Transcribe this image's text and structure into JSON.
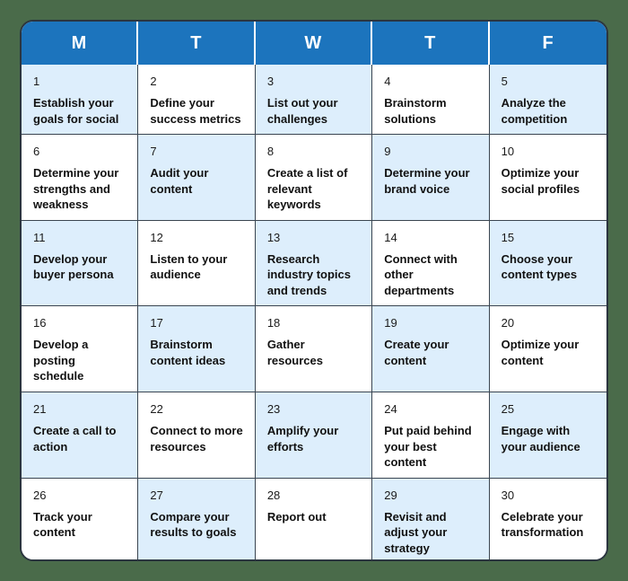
{
  "colors": {
    "page_background": "#4a6b4a",
    "header_blue": "#1c74bd",
    "cell_shaded_blue": "#ddeefc",
    "cell_plain": "#ffffff",
    "border": "#3a4550",
    "text": "#111111"
  },
  "calendar": {
    "day_headers": [
      "M",
      "T",
      "W",
      "T",
      "F"
    ],
    "rows": [
      [
        {
          "number": "1",
          "task": "Establish your goals for social",
          "shaded": true
        },
        {
          "number": "2",
          "task": "Define your success metrics",
          "shaded": false
        },
        {
          "number": "3",
          "task": "List out your challenges",
          "shaded": true
        },
        {
          "number": "4",
          "task": "Brainstorm solutions",
          "shaded": false
        },
        {
          "number": "5",
          "task": "Analyze the competition",
          "shaded": true
        }
      ],
      [
        {
          "number": "6",
          "task": "Determine your strengths and weakness",
          "shaded": false
        },
        {
          "number": "7",
          "task": "Audit your content",
          "shaded": true
        },
        {
          "number": "8",
          "task": "Create a list of relevant keywords",
          "shaded": false
        },
        {
          "number": "9",
          "task": "Determine your brand voice",
          "shaded": true
        },
        {
          "number": "10",
          "task": "Optimize your social profiles",
          "shaded": false
        }
      ],
      [
        {
          "number": "11",
          "task": "Develop your buyer persona",
          "shaded": true
        },
        {
          "number": "12",
          "task": "Listen to your audience",
          "shaded": false
        },
        {
          "number": "13",
          "task": "Research industry topics and trends",
          "shaded": true
        },
        {
          "number": "14",
          "task": "Connect with other departments",
          "shaded": false
        },
        {
          "number": "15",
          "task": "Choose your content types",
          "shaded": true
        }
      ],
      [
        {
          "number": "16",
          "task": "Develop a posting schedule",
          "shaded": false
        },
        {
          "number": "17",
          "task": "Brainstorm content ideas",
          "shaded": true
        },
        {
          "number": "18",
          "task": "Gather resources",
          "shaded": false
        },
        {
          "number": "19",
          "task": "Create your content",
          "shaded": true
        },
        {
          "number": "20",
          "task": "Optimize your content",
          "shaded": false
        }
      ],
      [
        {
          "number": "21",
          "task": "Create a call to action",
          "shaded": true
        },
        {
          "number": "22",
          "task": "Connect to more resources",
          "shaded": false
        },
        {
          "number": "23",
          "task": "Amplify your efforts",
          "shaded": true
        },
        {
          "number": "24",
          "task": "Put paid behind your best content",
          "shaded": false
        },
        {
          "number": "25",
          "task": "Engage with your audience",
          "shaded": true
        }
      ],
      [
        {
          "number": "26",
          "task": "Track your content",
          "shaded": false
        },
        {
          "number": "27",
          "task": "Compare your results to goals",
          "shaded": true
        },
        {
          "number": "28",
          "task": "Report out",
          "shaded": false
        },
        {
          "number": "29",
          "task": "Revisit and adjust your strategy",
          "shaded": true
        },
        {
          "number": "30",
          "task": "Celebrate your transformation",
          "shaded": false
        }
      ]
    ]
  }
}
